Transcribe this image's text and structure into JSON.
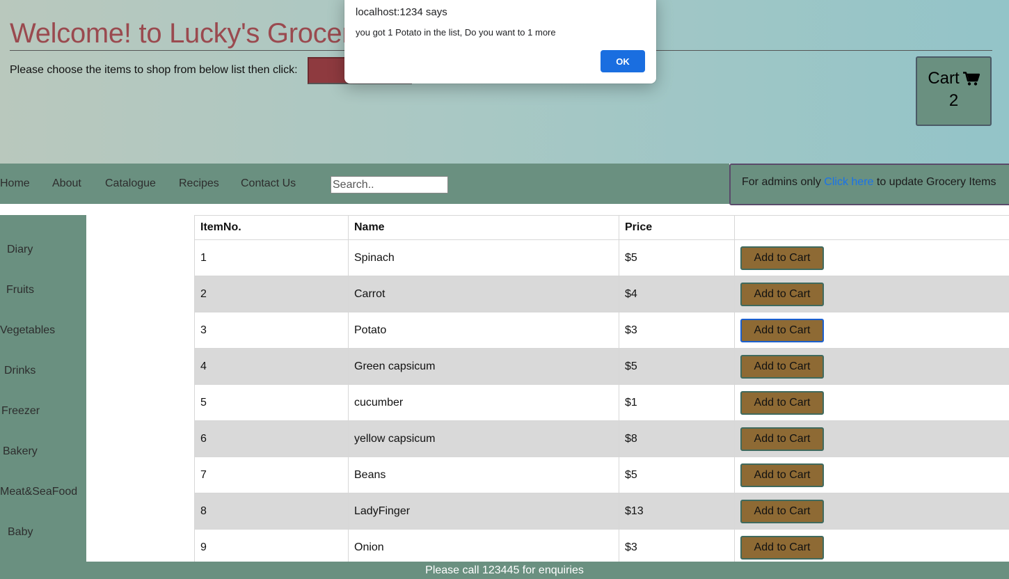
{
  "header": {
    "title": "Welcome! to Lucky's Grocer",
    "instruction": "Please choose the items to shop from below list then click:",
    "cart_label": "Cart",
    "cart_count": "2"
  },
  "nav": {
    "items": [
      "Home",
      "About",
      "Catalogue",
      "Recipes",
      "Contact Us"
    ],
    "search_placeholder": "Search.."
  },
  "admin": {
    "prefix": "For admins only",
    "link": "Click here",
    "suffix": "to update Grocery Items"
  },
  "sidebar": {
    "items": [
      "Diary",
      "Fruits",
      "Vegetables",
      "Drinks",
      "Freezer",
      "Bakery",
      "Meat&SeaFood",
      "Baby"
    ]
  },
  "table": {
    "headers": [
      "ItemNo.",
      "Name",
      "Price",
      ""
    ],
    "button_label": "Add to Cart",
    "rows": [
      {
        "no": "1",
        "name": "Spinach",
        "price": "$5"
      },
      {
        "no": "2",
        "name": "Carrot",
        "price": "$4"
      },
      {
        "no": "3",
        "name": "Potato",
        "price": "$3"
      },
      {
        "no": "4",
        "name": "Green capsicum",
        "price": "$5"
      },
      {
        "no": "5",
        "name": "cucumber",
        "price": "$1"
      },
      {
        "no": "6",
        "name": "yellow capsicum",
        "price": "$8"
      },
      {
        "no": "7",
        "name": "Beans",
        "price": "$5"
      },
      {
        "no": "8",
        "name": "LadyFinger",
        "price": "$13"
      },
      {
        "no": "9",
        "name": "Onion",
        "price": "$3"
      }
    ]
  },
  "footer": {
    "text": "Please call 123445 for enquiries"
  },
  "dialog": {
    "title": "localhost:1234 says",
    "message": "you got 1 Potato in the list, Do you want to 1 more",
    "ok_label": "OK"
  },
  "colors": {
    "brand_green": "#6a9080",
    "title_red": "#9a4a4f",
    "button_brown": "#8e6a34",
    "link_blue": "#1a73e8"
  }
}
